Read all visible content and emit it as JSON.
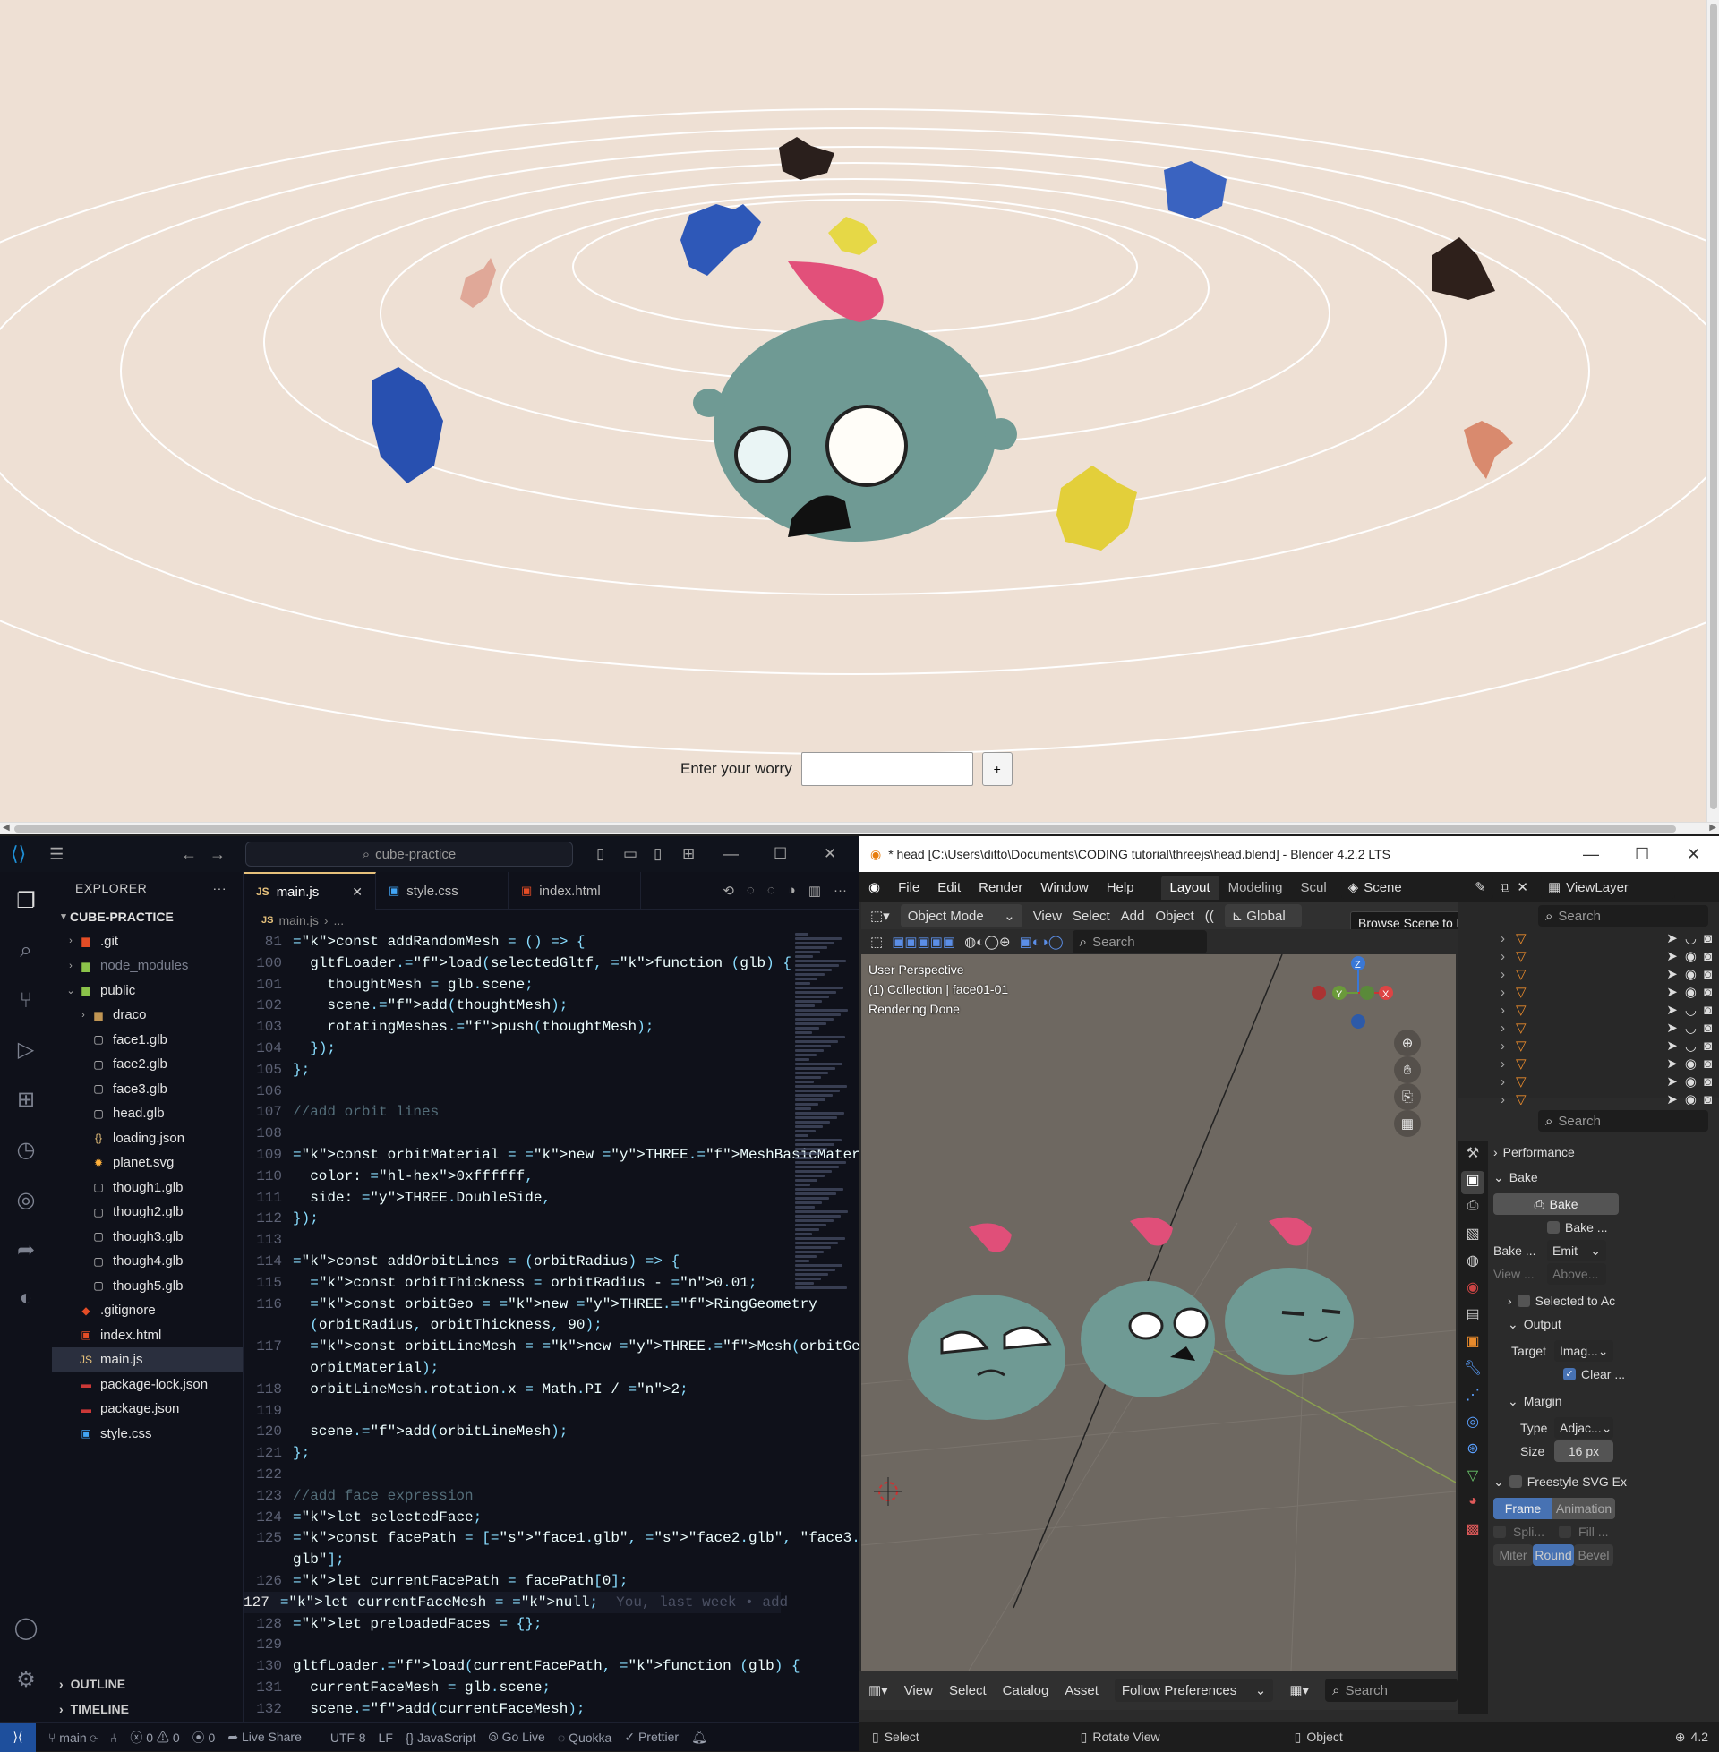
{
  "web": {
    "worry_label": "Enter your worry",
    "worry_value": "",
    "add_button": "+"
  },
  "vscode": {
    "search": "cube-practice",
    "explorer_title": "EXPLORER",
    "project": "CUBE-PRACTICE",
    "tree": [
      {
        "name": ".git",
        "type": "folder",
        "depth": 1,
        "collapsed": true,
        "icon_color": "#e44d26"
      },
      {
        "name": "node_modules",
        "type": "folder",
        "depth": 1,
        "collapsed": true,
        "icon_color": "#8bc34a",
        "dim": true
      },
      {
        "name": "public",
        "type": "folder",
        "depth": 1,
        "collapsed": false,
        "icon_color": "#8bc34a"
      },
      {
        "name": "draco",
        "type": "folder",
        "depth": 2,
        "collapsed": true,
        "icon_color": "#c09553"
      },
      {
        "name": "face1.glb",
        "type": "file",
        "depth": 2,
        "icon": "file"
      },
      {
        "name": "face2.glb",
        "type": "file",
        "depth": 2,
        "icon": "file"
      },
      {
        "name": "face3.glb",
        "type": "file",
        "depth": 2,
        "icon": "file"
      },
      {
        "name": "head.glb",
        "type": "file",
        "depth": 2,
        "icon": "file"
      },
      {
        "name": "loading.json",
        "type": "file",
        "depth": 2,
        "icon": "json"
      },
      {
        "name": "planet.svg",
        "type": "file",
        "depth": 2,
        "icon": "svg"
      },
      {
        "name": "though1.glb",
        "type": "file",
        "depth": 2,
        "icon": "file"
      },
      {
        "name": "though2.glb",
        "type": "file",
        "depth": 2,
        "icon": "file"
      },
      {
        "name": "though3.glb",
        "type": "file",
        "depth": 2,
        "icon": "file"
      },
      {
        "name": "though4.glb",
        "type": "file",
        "depth": 2,
        "icon": "file"
      },
      {
        "name": "though5.glb",
        "type": "file",
        "depth": 2,
        "icon": "file"
      },
      {
        "name": ".gitignore",
        "type": "file",
        "depth": 1,
        "icon": "git"
      },
      {
        "name": "index.html",
        "type": "file",
        "depth": 1,
        "icon": "html"
      },
      {
        "name": "main.js",
        "type": "file",
        "depth": 1,
        "icon": "js",
        "selected": true
      },
      {
        "name": "package-lock.json",
        "type": "file",
        "depth": 1,
        "icon": "npm"
      },
      {
        "name": "package.json",
        "type": "file",
        "depth": 1,
        "icon": "npm"
      },
      {
        "name": "style.css",
        "type": "file",
        "depth": 1,
        "icon": "css"
      }
    ],
    "outline": "OUTLINE",
    "timeline": "TIMELINE",
    "tabs": [
      {
        "label": "main.js",
        "icon": "JS",
        "active": true
      },
      {
        "label": "style.css",
        "icon": "css"
      },
      {
        "label": "index.html",
        "icon": "html"
      }
    ],
    "breadcrumb": [
      "main.js",
      "..."
    ],
    "code_lines": [
      {
        "n": "81",
        "t": "const addRandomMesh = () => {"
      },
      {
        "n": "100",
        "t": "  gltfLoader.load(selectedGltf, function (glb) {"
      },
      {
        "n": "101",
        "t": "    thoughtMesh = glb.scene;"
      },
      {
        "n": "102",
        "t": "    scene.add(thoughtMesh);"
      },
      {
        "n": "103",
        "t": "    rotatingMeshes.push(thoughtMesh);"
      },
      {
        "n": "104",
        "t": "  });"
      },
      {
        "n": "105",
        "t": "};"
      },
      {
        "n": "106",
        "t": ""
      },
      {
        "n": "107",
        "t": "//add orbit lines"
      },
      {
        "n": "108",
        "t": ""
      },
      {
        "n": "109",
        "t": "const orbitMaterial = new THREE.MeshBasicMaterial({"
      },
      {
        "n": "110",
        "t": "  color: 0xffffff,"
      },
      {
        "n": "111",
        "t": "  side: THREE.DoubleSide,"
      },
      {
        "n": "112",
        "t": "});"
      },
      {
        "n": "113",
        "t": ""
      },
      {
        "n": "114",
        "t": "const addOrbitLines = (orbitRadius) => {"
      },
      {
        "n": "115",
        "t": "  const orbitThickness = orbitRadius - 0.01;"
      },
      {
        "n": "116",
        "t": "  const orbitGeo = new THREE.RingGeometry"
      },
      {
        "n": "",
        "t": "  (orbitRadius, orbitThickness, 90);"
      },
      {
        "n": "117",
        "t": "  const orbitLineMesh = new THREE.Mesh(orbitGeo,"
      },
      {
        "n": "",
        "t": "  orbitMaterial);"
      },
      {
        "n": "118",
        "t": "  orbitLineMesh.rotation.x = Math.PI / 2;"
      },
      {
        "n": "119",
        "t": ""
      },
      {
        "n": "120",
        "t": "  scene.add(orbitLineMesh);"
      },
      {
        "n": "121",
        "t": "};"
      },
      {
        "n": "122",
        "t": ""
      },
      {
        "n": "123",
        "t": "//add face expression"
      },
      {
        "n": "124",
        "t": "let selectedFace;"
      },
      {
        "n": "125",
        "t": "const facePath = [\"face1.glb\", \"face2.glb\", \"face3."
      },
      {
        "n": "",
        "t": "glb\"];"
      },
      {
        "n": "126",
        "t": "let currentFacePath = facePath[0];"
      },
      {
        "n": "127",
        "t": "let currentFaceMesh = null;",
        "blame": "You, last week • add",
        "current": true
      },
      {
        "n": "128",
        "t": "let preloadedFaces = {};"
      },
      {
        "n": "129",
        "t": ""
      },
      {
        "n": "130",
        "t": "gltfLoader.load(currentFacePath, function (glb) {"
      },
      {
        "n": "131",
        "t": "  currentFaceMesh = glb.scene;"
      },
      {
        "n": "132",
        "t": "  scene.add(currentFaceMesh);"
      }
    ],
    "status": {
      "branch": "main",
      "errors": "0",
      "warnings": "0",
      "ports": "0",
      "live_share": "Live Share",
      "encoding": "UTF-8",
      "eol": "LF",
      "language": "JavaScript",
      "go_live": "Go Live",
      "quokka": "Quokka",
      "prettier": "Prettier"
    }
  },
  "blender": {
    "title": "* head [C:\\Users\\ditto\\Documents\\CODING tutorial\\threejs\\head.blend] - Blender 4.2.2 LTS",
    "menus": [
      "File",
      "Edit",
      "Render",
      "Window",
      "Help"
    ],
    "workspaces": [
      "Layout",
      "Modeling",
      "Scul"
    ],
    "scene": "Scene",
    "view_layer": "ViewLayer",
    "mode": "Object Mode",
    "header_menus": [
      "View",
      "Select",
      "Add",
      "Object"
    ],
    "orientation": "Global",
    "tooltip": "Browse Scene to be linked.",
    "search_placeholder": "Search",
    "viewport_info": [
      "User Perspective",
      "(1) Collection | face01-01",
      "Rendering Done"
    ],
    "outliner_search": "Search",
    "props_search": "Search",
    "props": {
      "performance": "Performance",
      "bake_section": "Bake",
      "bake_button": "Bake",
      "bake_multires": "Bake ...",
      "bake_type_label": "Bake ...",
      "bake_type": "Emit",
      "view_from_label": "View ...",
      "view_from": "Above...",
      "selected_to_active": "Selected to Ac",
      "output": "Output",
      "target_label": "Target",
      "target": "Imag...",
      "clear": "Clear ...",
      "margin": "Margin",
      "type_label": "Type",
      "type": "Adjac...",
      "size_label": "Size",
      "size": "16 px",
      "freestyle": "Freestyle SVG Ex",
      "frame": "Frame",
      "animation": "Animation",
      "split": "Spli...",
      "fill": "Fill ...",
      "miter": "Miter",
      "round": "Round",
      "bevel": "Bevel"
    },
    "bottom_menus": [
      "View",
      "Select",
      "Catalog",
      "Asset"
    ],
    "follow_prefs": "Follow Preferences",
    "bottom_search": "Search",
    "status": {
      "select": "Select",
      "rotate": "Rotate View",
      "object": "Object",
      "version": "4.2"
    }
  }
}
